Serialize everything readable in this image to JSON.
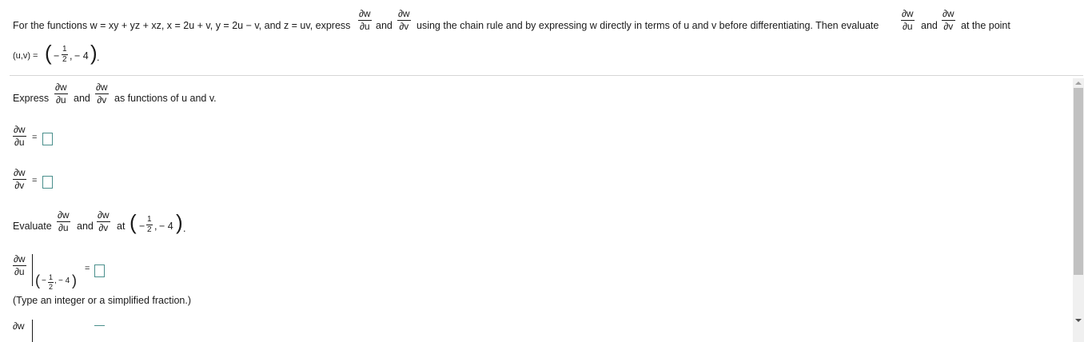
{
  "question": {
    "intro": "For the functions w = xy + yz + xz, x = 2u + v, y = 2u − v, and z = uv, express",
    "and": "and",
    "middle": "using the chain rule and by expressing w directly in terms of u and v before differentiating. Then evaluate",
    "at_the_point": "at the point",
    "point_label": "(u,v) =",
    "num_w": "∂w",
    "den_u": "∂u",
    "den_v": "∂v",
    "point": {
      "minus": "−",
      "half_num": "1",
      "half_den": "2",
      "comma": ",",
      "second": "− 4",
      "period": "."
    }
  },
  "part1": {
    "express": "Express",
    "and": "and",
    "suffix": "as functions of u and v.",
    "eq": "="
  },
  "part2": {
    "evaluate": "Evaluate",
    "and": "and",
    "at": "at",
    "eq": "=",
    "hint": "(Type an integer or a simplified fraction.)"
  }
}
